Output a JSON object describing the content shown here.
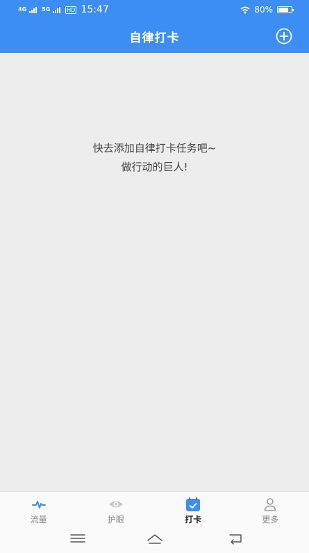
{
  "status_bar": {
    "signal_1": "4G",
    "signal_2": "5G",
    "hd": "HD",
    "time": "15:47",
    "battery": "80%",
    "battery_level": 0.8
  },
  "header": {
    "title": "自律打卡",
    "add_icon": "plus-circle-icon"
  },
  "empty_state": {
    "line1": "快去添加自律打卡任务吧~",
    "line2": "做行动的巨人!"
  },
  "tabs": [
    {
      "label": "流量",
      "icon": "pulse-icon",
      "active": false
    },
    {
      "label": "护眼",
      "icon": "eye-icon",
      "active": false
    },
    {
      "label": "打卡",
      "icon": "calendar-check-icon",
      "active": true
    },
    {
      "label": "更多",
      "icon": "person-icon",
      "active": false
    }
  ],
  "system_nav": {
    "menu_icon": "menu-icon",
    "home_icon": "home-icon",
    "back_icon": "back-icon"
  },
  "colors": {
    "primary": "#3d8ef2",
    "background": "#ededed",
    "tab_inactive": "#8a8a8a"
  }
}
